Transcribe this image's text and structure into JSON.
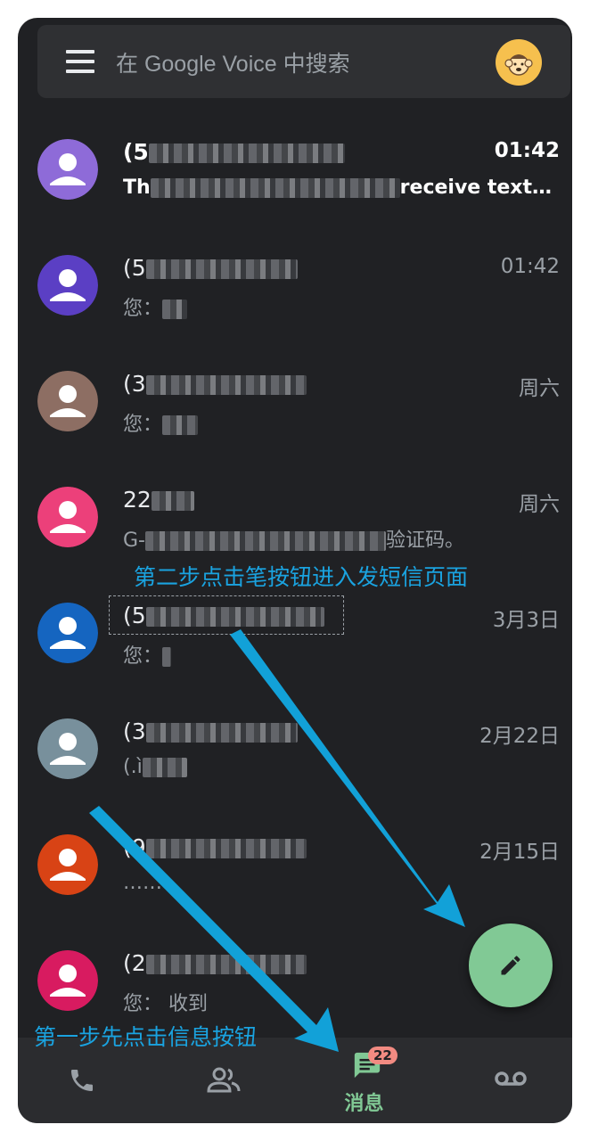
{
  "search": {
    "placeholder": "在 Google Voice 中搜索"
  },
  "conversations": [
    {
      "name": "(5",
      "time": "01:42",
      "snippet_prefix": "Th",
      "snippet_suffix": "receive text…",
      "unread": true,
      "avatar_color": "#8e6bd8"
    },
    {
      "name": "(5",
      "time": "01:42",
      "snippet_prefix": "您：",
      "snippet_suffix": "",
      "unread": false,
      "avatar_color": "#5b3fc4"
    },
    {
      "name": "(3",
      "time": "周六",
      "snippet_prefix": "您：",
      "snippet_suffix": "",
      "unread": false,
      "avatar_color": "#8d6e63"
    },
    {
      "name": "22",
      "time": "周六",
      "snippet_prefix": "G-",
      "snippet_suffix": "验证码。",
      "unread": false,
      "avatar_color": "#ec407a"
    },
    {
      "name": "(5",
      "time": "3月3日",
      "snippet_prefix": "您：",
      "snippet_suffix": "",
      "unread": false,
      "avatar_color": "#1565c0"
    },
    {
      "name": "(3",
      "time": "2月22日",
      "snippet_prefix": "(.ì",
      "snippet_suffix": "",
      "unread": false,
      "avatar_color": "#78909c"
    },
    {
      "name": "(9",
      "time": "2月15日",
      "snippet_prefix": "……",
      "snippet_suffix": "",
      "unread": false,
      "avatar_color": "#d84315"
    },
    {
      "name": "(2",
      "time": "",
      "snippet_prefix": "您：",
      "snippet_suffix": "收到",
      "unread": false,
      "avatar_color": "#d81b60"
    }
  ],
  "bottom_nav": {
    "calls_icon": "phone-icon",
    "contacts_icon": "contacts-icon",
    "messages_label": "消息",
    "messages_badge": "22",
    "voicemail_icon": "voicemail-icon"
  },
  "annotations": {
    "step_two": "第二步点击笔按钮进入发短信页面",
    "step_one": "第一步先点击信息按钮"
  },
  "colors": {
    "background": "#202124",
    "accent_green": "#81c995",
    "annotation_blue": "#1aa3e0",
    "badge_red": "#f28b82"
  }
}
